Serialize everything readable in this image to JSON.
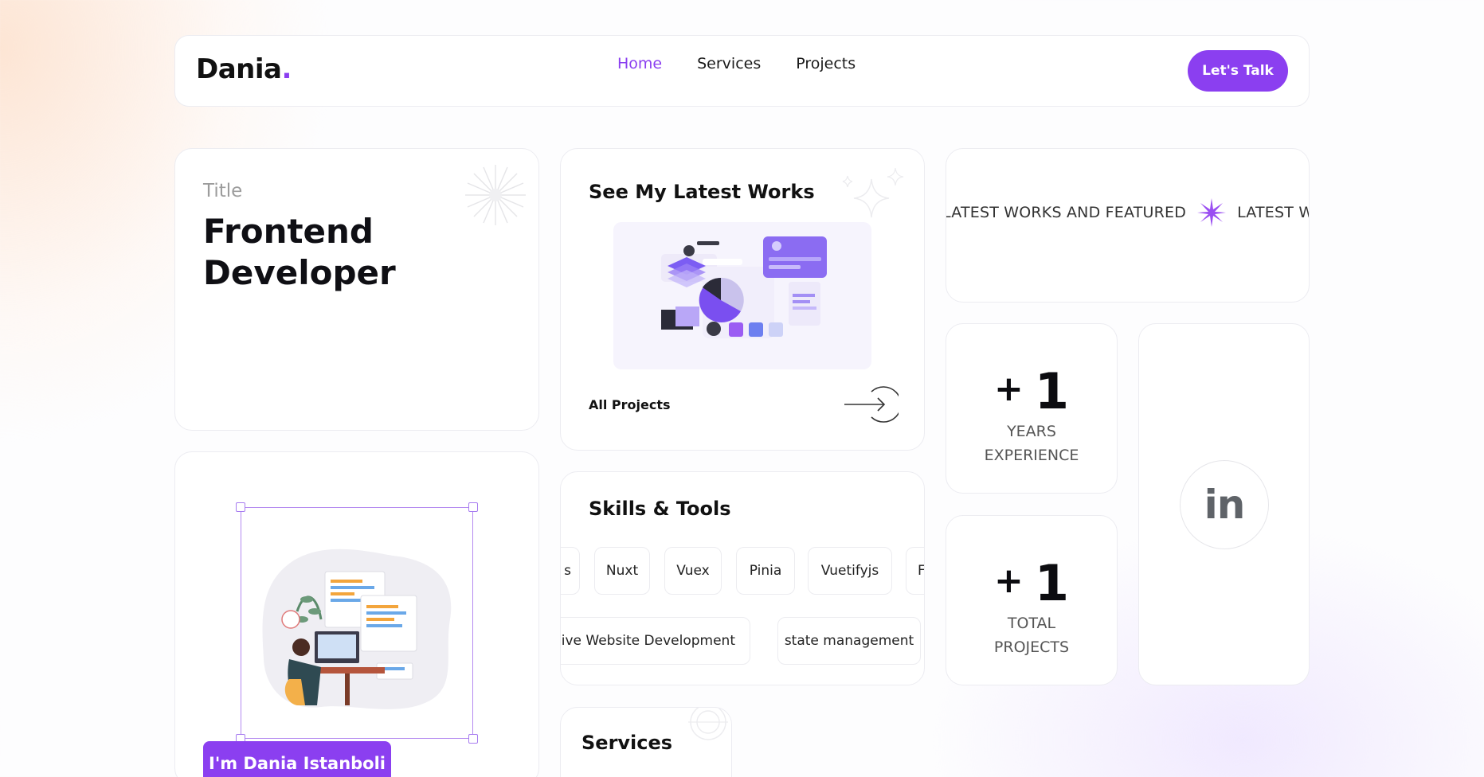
{
  "nav": {
    "logo_text": "Dania",
    "logo_dot": ".",
    "links": [
      {
        "label": "Home",
        "active": true
      },
      {
        "label": "Services",
        "active": false
      },
      {
        "label": "Projects",
        "active": false
      }
    ],
    "cta_label": "Let's Talk"
  },
  "title_card": {
    "label": "Title",
    "role_line1": "Frontend",
    "role_line2": "Developer"
  },
  "works_card": {
    "title": "See My Latest Works",
    "link_label": "All Projects"
  },
  "marquee": {
    "items": [
      "LATEST WORKS AND FEATURED",
      "LATEST WORKS"
    ]
  },
  "stats": [
    {
      "prefix": "+",
      "value": "1",
      "label_line1": "YEARS",
      "label_line2": "EXPERIENCE"
    },
    {
      "prefix": "+",
      "value": "1",
      "label_line1": "TOTAL",
      "label_line2": "PROJECTS"
    }
  ],
  "linkedin": {
    "label": "in"
  },
  "skills": {
    "title": "Skills & Tools",
    "row1": [
      "s",
      "Nuxt",
      "Vuex",
      "Pinia",
      "Vuetifyjs",
      "F"
    ],
    "row2": [
      "ponsive Website Development",
      "state management"
    ]
  },
  "profile": {
    "name_label": "I'm Dania Istanboli"
  },
  "services": {
    "title": "Services"
  },
  "colors": {
    "accent": "#8b3ff0",
    "text": "#111111",
    "muted": "#9c9c9c"
  },
  "icons": [
    "sparkle-icon",
    "arrow-right-circle-icon",
    "star-burst-icon",
    "linkedin-icon"
  ]
}
